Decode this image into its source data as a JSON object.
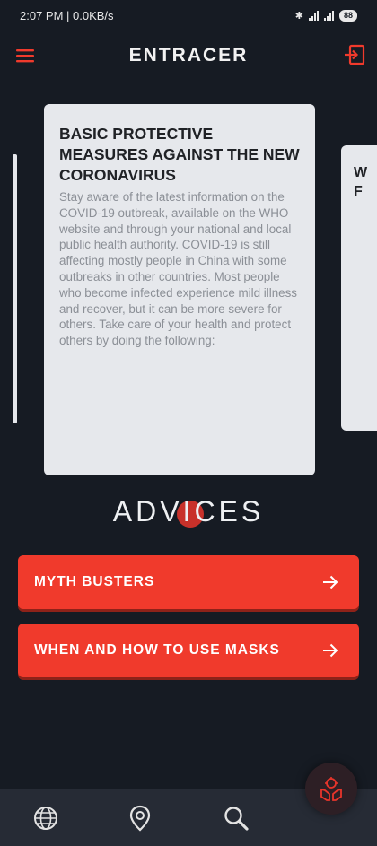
{
  "status_bar": {
    "time_speed": "2:07 PM | 0.0KB/s",
    "battery": "88"
  },
  "app_bar": {
    "title": "ENTRACER"
  },
  "carousel": {
    "main_card": {
      "title": "BASIC PROTECTIVE MEASURES AGAINST THE NEW CORONAVIRUS",
      "body": "Stay aware of the latest information on the COVID-19 outbreak, available on the WHO website and through your national and local public health authority. COVID-19 is still affecting mostly people in China with some outbreaks in other countries. Most people who become infected experience mild illness and recover, but it can be more severe for others. Take care of your health and protect others by doing the following:"
    },
    "next_card": {
      "title_partial": "W\nF"
    }
  },
  "section": {
    "heading": "ADVICES"
  },
  "buttons": [
    {
      "label": "MYTH BUSTERS"
    },
    {
      "label": "WHEN AND HOW TO USE MASKS"
    }
  ],
  "colors": {
    "accent": "#f03a2c",
    "background": "#161b23",
    "card": "#e6e8ec",
    "nav": "#262b35"
  },
  "icons": {
    "menu": "menu-icon",
    "logout": "logout-icon",
    "globe": "globe-icon",
    "location": "location-pin-icon",
    "search": "search-icon",
    "fab": "hands-virus-icon",
    "arrow": "arrow-right-icon"
  }
}
